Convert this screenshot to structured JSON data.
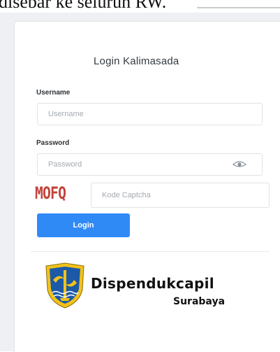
{
  "header": {
    "partial_text": "disebar ke seluruh RW."
  },
  "login": {
    "title": "Login Kalimasada",
    "username_label": "Username",
    "username_placeholder": "Username",
    "password_label": "Password",
    "password_placeholder": "Password",
    "captcha_code": "MOFQ",
    "captcha_placeholder": "Kode Captcha",
    "login_button": "Login",
    "show_password_icon": "eye-icon"
  },
  "logo": {
    "main": "Dispendukcapil",
    "sub": "Surabaya",
    "emblem_icon": "city-emblem-icon"
  },
  "colors": {
    "primary": "#2f8af5",
    "captcha": "#c1443b",
    "emblem_blue": "#1c5aa8",
    "emblem_gold": "#f2c21a"
  }
}
